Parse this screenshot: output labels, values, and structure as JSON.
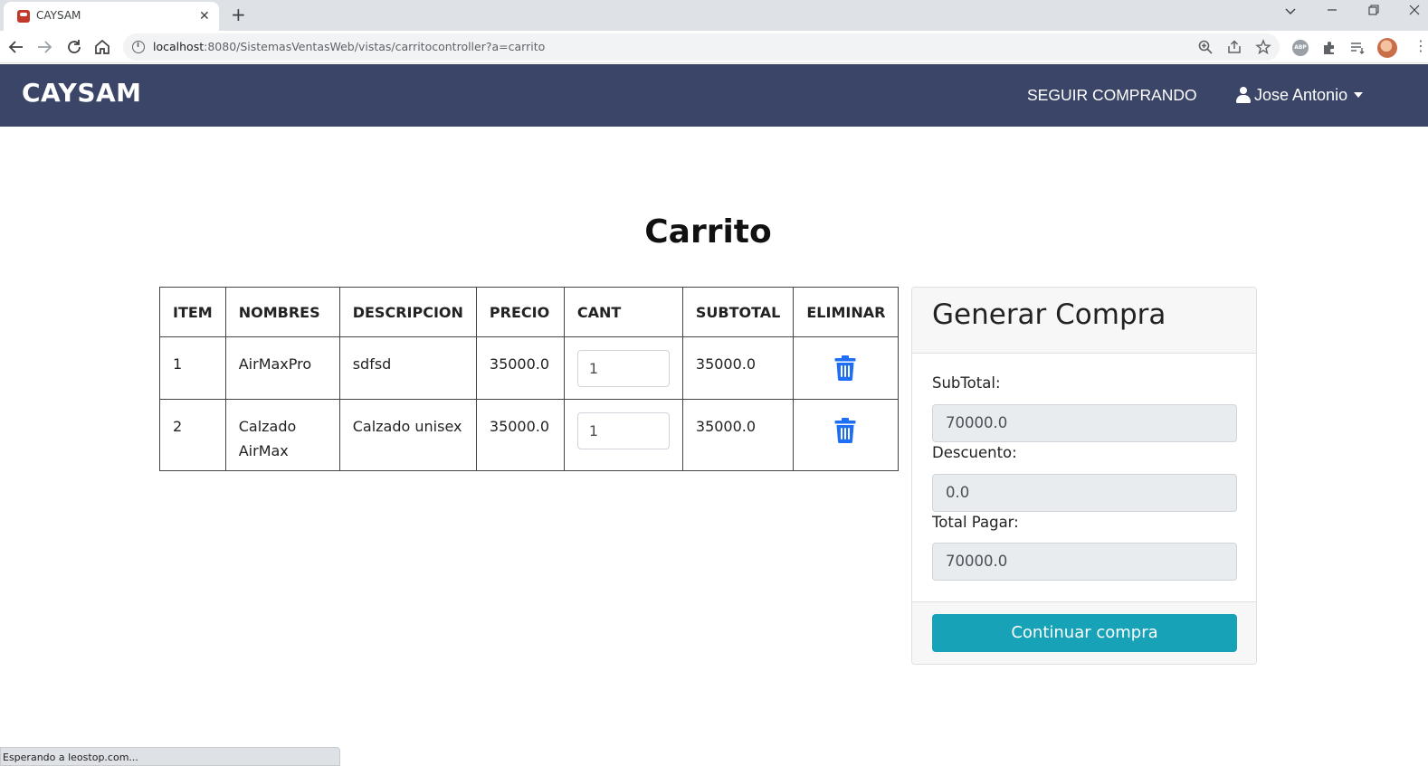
{
  "browser": {
    "tab_title": "CAYSAM",
    "url_host": "localhost",
    "url_rest": ":8080/SistemasVentasWeb/vistas/carritocontroller?a=carrito",
    "status_text": "Esperando a leostop.com..."
  },
  "navbar": {
    "brand": "CAYSAM",
    "continue_shopping": "SEGUIR COMPRANDO",
    "user_name": "Jose Antonio"
  },
  "page": {
    "title": "Carrito"
  },
  "cart": {
    "headers": [
      "ITEM",
      "NOMBRES",
      "DESCRIPCION",
      "PRECIO",
      "CANT",
      "SUBTOTAL",
      "ELIMINAR"
    ],
    "rows": [
      {
        "item": "1",
        "nombre": "AirMaxPro",
        "descripcion": "sdfsd",
        "precio": "35000.0",
        "cant": "1",
        "subtotal": "35000.0"
      },
      {
        "item": "2",
        "nombre": "Calzado AirMax",
        "descripcion": "Calzado unisex",
        "precio": "35000.0",
        "cant": "1",
        "subtotal": "35000.0"
      }
    ]
  },
  "summary": {
    "title": "Generar Compra",
    "subtotal_label": "SubTotal:",
    "subtotal_value": "70000.0",
    "descuento_label": "Descuento:",
    "descuento_value": "0.0",
    "total_label": "Total Pagar:",
    "total_value": "70000.0",
    "button_label": "Continuar compra"
  },
  "colors": {
    "navbar": "#3b4567",
    "button": "#17a2b8",
    "trash_icon": "#1e6ff5"
  }
}
